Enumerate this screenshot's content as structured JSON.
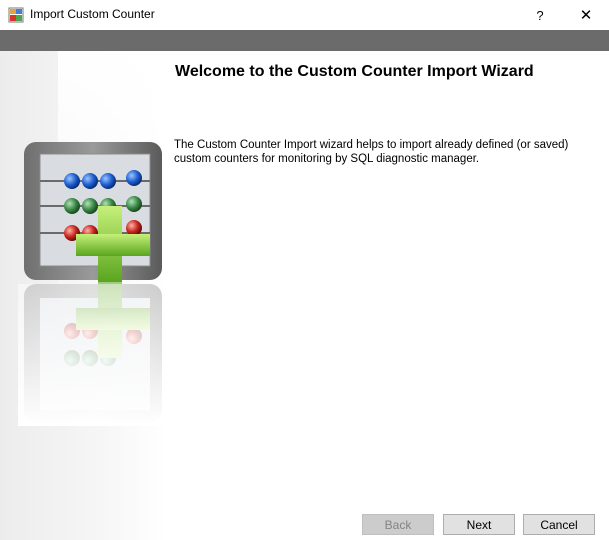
{
  "window": {
    "title": "Import Custom Counter",
    "help_glyph": "?",
    "close_glyph": "✕"
  },
  "wizard": {
    "heading": "Welcome to the Custom Counter Import Wizard",
    "description": "The Custom Counter Import wizard helps to import already defined (or saved) custom counters for monitoring by SQL diagnostic manager."
  },
  "buttons": {
    "back": "Back",
    "next": "Next",
    "cancel": "Cancel",
    "back_enabled": false
  },
  "icons": {
    "app": "form-window-icon",
    "illustration": "abacus-plus-icon",
    "help": "help-icon",
    "close": "close-icon"
  },
  "colors": {
    "header_bar": "#6b6b6b",
    "bead_blue": "#1f5fd0",
    "bead_green": "#3a8a46",
    "bead_red": "#c8261f",
    "plus_green": "#7dc832"
  }
}
